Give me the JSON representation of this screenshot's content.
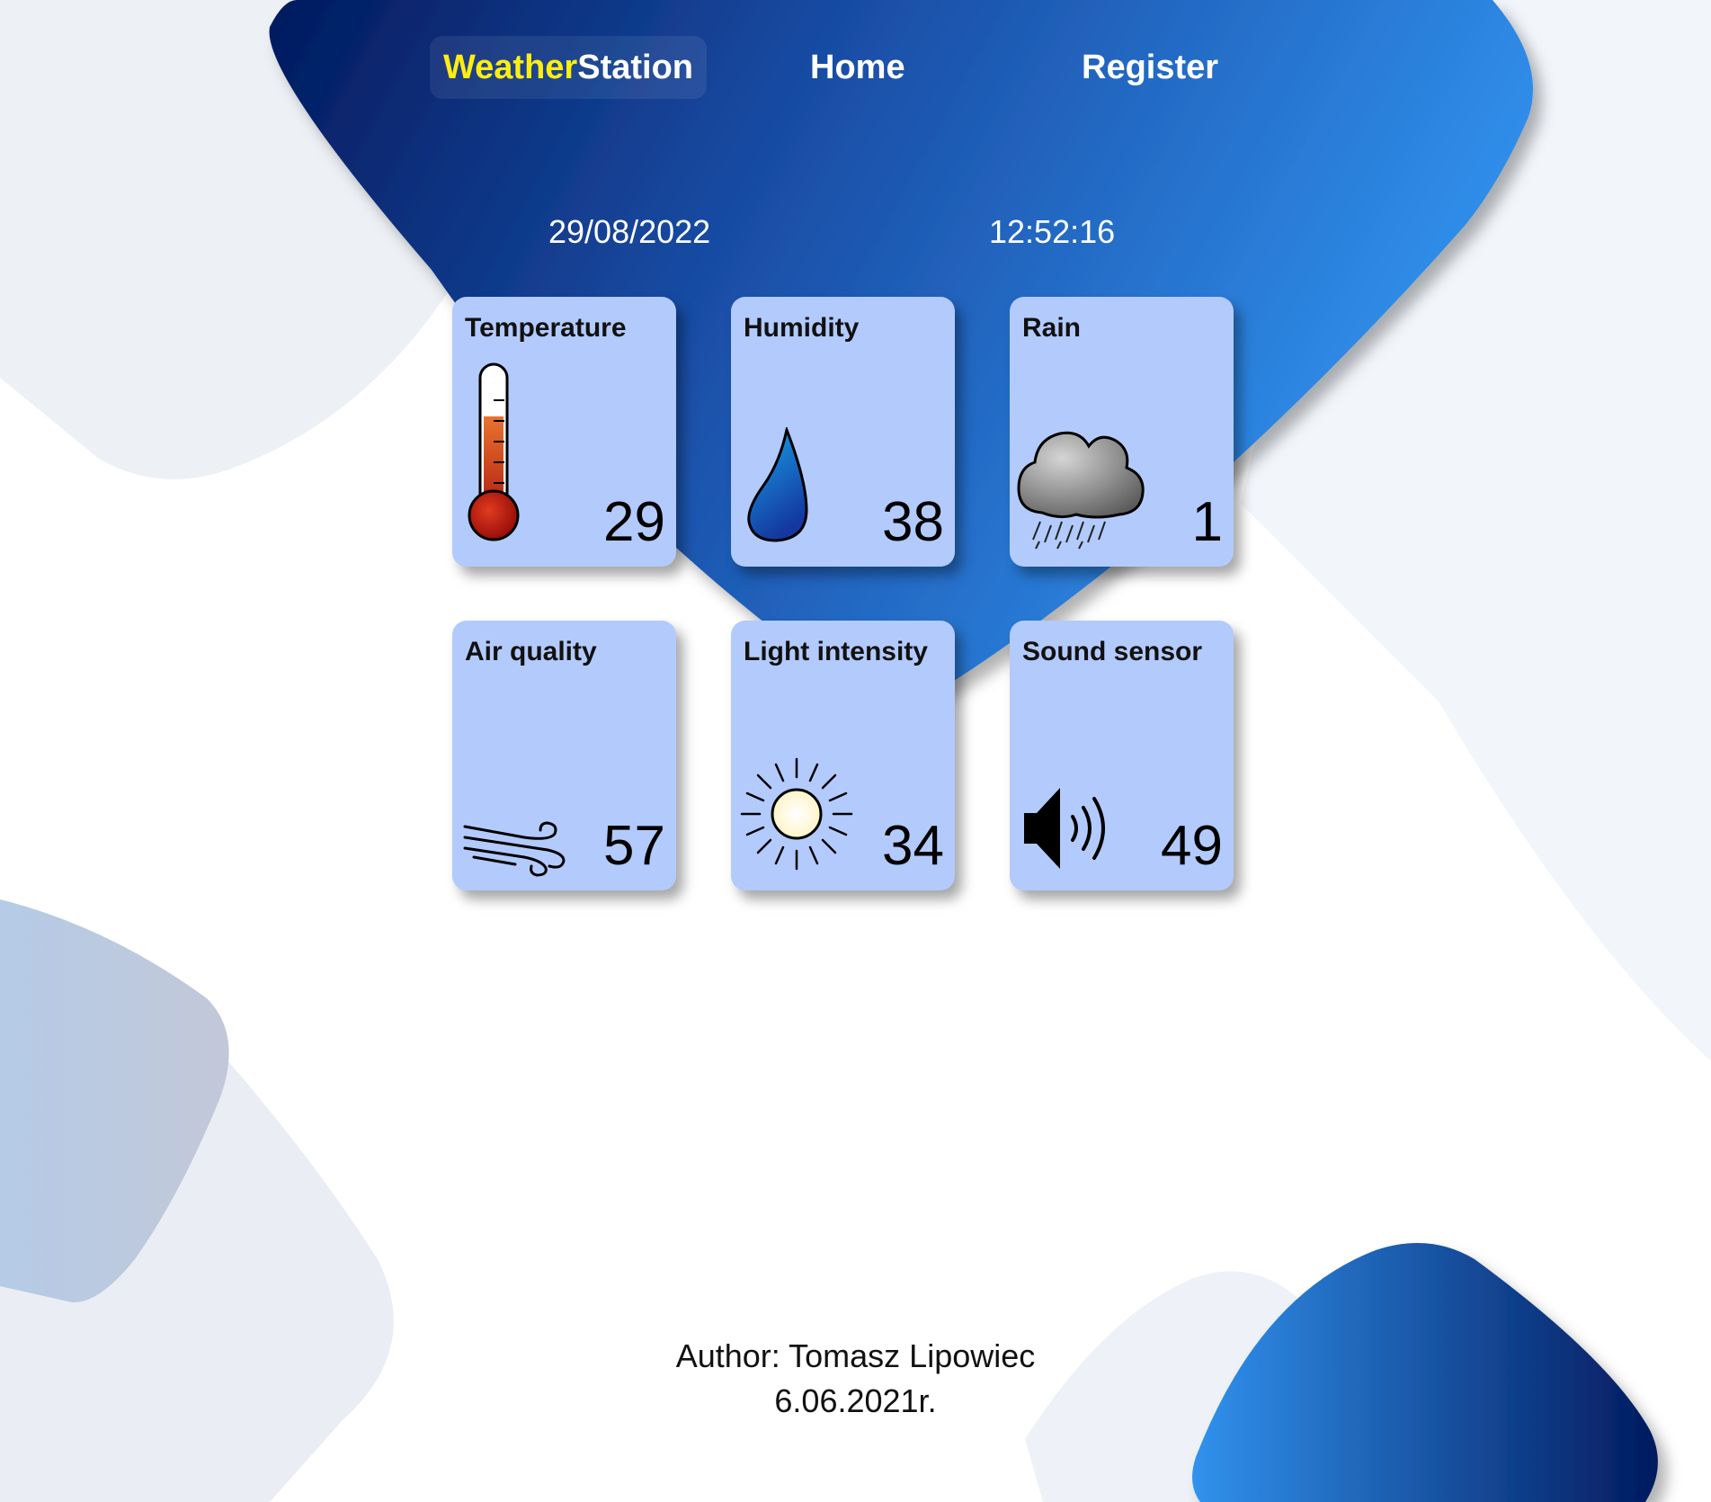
{
  "nav": {
    "brand_part1": "Weather",
    "brand_part2": "Station",
    "home_label": "Home",
    "register_label": "Register"
  },
  "date": "29/08/2022",
  "time": "12:52:16",
  "sensors": [
    {
      "title": "Temperature",
      "value": "29",
      "icon": "thermometer-icon"
    },
    {
      "title": "Humidity",
      "value": "38",
      "icon": "water-drop-icon"
    },
    {
      "title": "Rain",
      "value": "1",
      "icon": "rain-cloud-icon"
    },
    {
      "title": "Air quality",
      "value": "57",
      "icon": "wind-icon"
    },
    {
      "title": "Light intensity",
      "value": "34",
      "icon": "sun-icon"
    },
    {
      "title": "Sound sensor",
      "value": "49",
      "icon": "speaker-icon"
    }
  ],
  "footer": {
    "author": "Author: Tomasz Lipowiec",
    "date": "6.06.2021r."
  },
  "colors": {
    "header_dark": "#021a5e",
    "header_light": "#3192ee",
    "brand_accent": "#ffee10",
    "card_bg": "#b3cafd"
  }
}
